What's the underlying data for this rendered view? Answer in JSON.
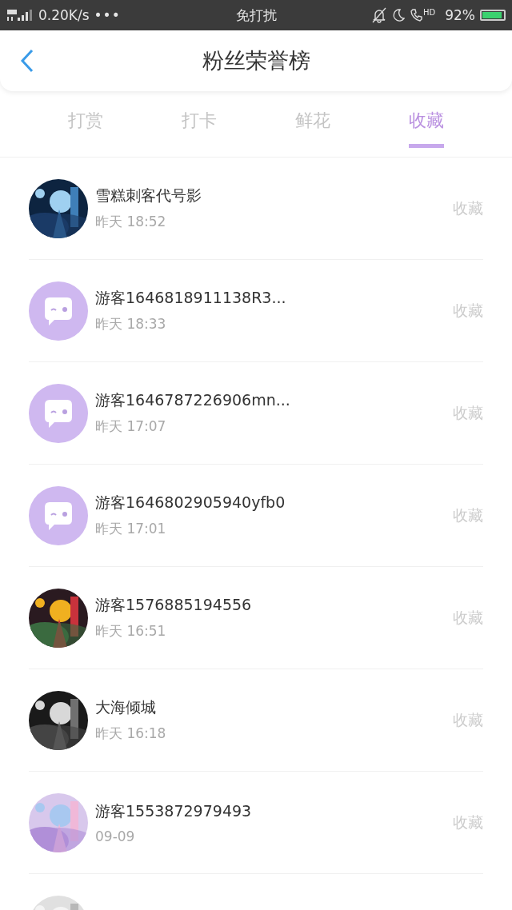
{
  "status_bar": {
    "network": "0.20K/s",
    "more": "•••",
    "mode": "免打扰",
    "hd": "HD",
    "battery": "92%"
  },
  "header": {
    "title": "粉丝荣誉榜"
  },
  "tabs": [
    {
      "label": "打赏",
      "selected": false
    },
    {
      "label": "打卡",
      "selected": false
    },
    {
      "label": "鲜花",
      "selected": false
    },
    {
      "label": "收藏",
      "selected": true
    }
  ],
  "rows": [
    {
      "kind": "picture",
      "name": "雪糕刺客代号影",
      "time": "昨天 18:52",
      "action": "收藏"
    },
    {
      "kind": "default",
      "name": "游客1646818911138R3...",
      "time": "昨天 18:33",
      "action": "收藏"
    },
    {
      "kind": "default",
      "name": "游客1646787226906mn...",
      "time": "昨天 17:07",
      "action": "收藏"
    },
    {
      "kind": "default",
      "name": "游客1646802905940yfb0",
      "time": "昨天 17:01",
      "action": "收藏"
    },
    {
      "kind": "picture",
      "name": "游客1576885194556",
      "time": "昨天 16:51",
      "action": "收藏"
    },
    {
      "kind": "picture",
      "name": "大海倾城",
      "time": "昨天 16:18",
      "action": "收藏"
    },
    {
      "kind": "picture",
      "name": "游客1553872979493",
      "time": "09-09",
      "action": "收藏"
    },
    {
      "kind": "picture"
    }
  ]
}
